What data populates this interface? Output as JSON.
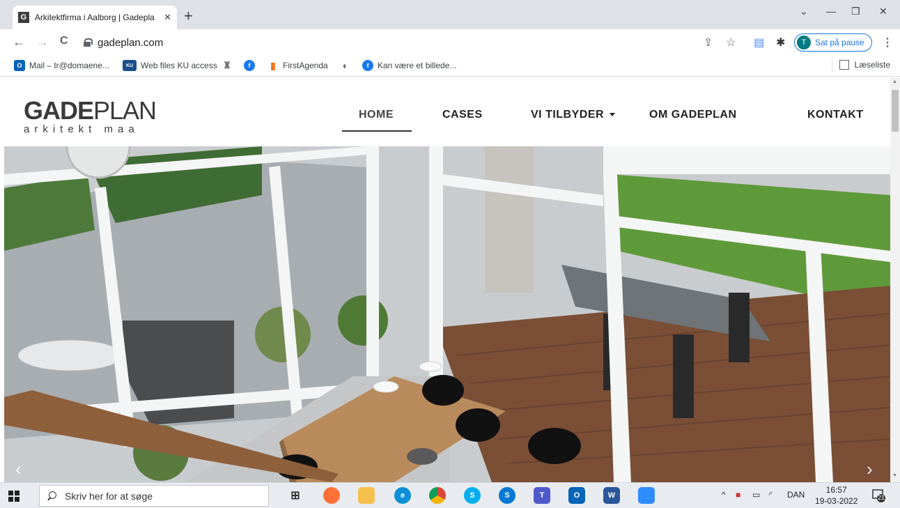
{
  "browser": {
    "tab": {
      "title": "Arkitektfirma i Aalborg | Gadepla",
      "favicon_letter": "G",
      "close": "✕"
    },
    "new_tab": "+",
    "window_controls": {
      "minimize": "—",
      "restore": "❐",
      "close": "✕",
      "chevron": "⌄"
    },
    "nav": {
      "back": "←",
      "forward": "→",
      "reload": "C"
    },
    "url": "gadeplan.com",
    "profile": {
      "initial": "T",
      "label": "Sat på pause"
    },
    "menu": "⋮",
    "bookmarks": [
      {
        "label": "Mail – tr@domaene...",
        "icon": "outlook-icon",
        "color": "#0364b8",
        "glyph": "O"
      },
      {
        "label": "Web files KU access",
        "icon": "ku-web-icon",
        "color": "#1a4f8b",
        "glyph": "KU"
      },
      {
        "label": "",
        "icon": "crest-icon",
        "color": "#8a8a8a",
        "glyph": "♜"
      },
      {
        "label": "",
        "icon": "facebook-icon",
        "color": "#1877f2",
        "glyph": "f"
      },
      {
        "label": "FirstAgenda",
        "icon": "firstagenda-icon",
        "color": "#f47a20",
        "glyph": "▮"
      },
      {
        "label": "",
        "icon": "globe-icon",
        "color": "#5f6368",
        "glyph": "◐"
      },
      {
        "label": "Kan være et billede...",
        "icon": "facebook-icon",
        "color": "#1877f2",
        "glyph": "f"
      }
    ],
    "reading_list": "Læseliste"
  },
  "site": {
    "logo": {
      "bold": "GADE",
      "light": "PLAN",
      "tagline": "arkitekt maa"
    },
    "nav": [
      {
        "label": "HOME",
        "active": true
      },
      {
        "label": "CASES",
        "active": false
      },
      {
        "label": "VI TILBYDER",
        "active": false,
        "dropdown": true
      },
      {
        "label": "OM GADEPLAN",
        "active": false
      },
      {
        "label": "KONTAKT",
        "active": false
      }
    ],
    "slider": {
      "prev": "‹",
      "next": "›"
    }
  },
  "taskbar": {
    "search_placeholder": "Skriv her for at søge",
    "apps": [
      {
        "name": "task-view-icon",
        "color": "#e8ecf0",
        "glyph": "⊞"
      },
      {
        "name": "firefox-icon",
        "color": "#ff7139",
        "glyph": "●"
      },
      {
        "name": "file-explorer-icon",
        "color": "#f5c04b",
        "glyph": "▬"
      },
      {
        "name": "edge-icon",
        "color": "#0c8fd6",
        "glyph": "e"
      },
      {
        "name": "chrome-icon",
        "color": "#db4437",
        "glyph": "●"
      },
      {
        "name": "skype-icon",
        "color": "#00aff0",
        "glyph": "S"
      },
      {
        "name": "skype-business-icon",
        "color": "#0078d4",
        "glyph": "S"
      },
      {
        "name": "teams-icon",
        "color": "#5059c9",
        "glyph": "T"
      },
      {
        "name": "outlook-icon",
        "color": "#0364b8",
        "glyph": "O"
      },
      {
        "name": "word-icon",
        "color": "#2b579a",
        "glyph": "W"
      },
      {
        "name": "zoom-icon",
        "color": "#2d8cff",
        "glyph": "■"
      }
    ],
    "tray": {
      "chevron": "^",
      "language": "DAN"
    },
    "time": "16:57",
    "date": "19-03-2022",
    "notifications": "21"
  }
}
